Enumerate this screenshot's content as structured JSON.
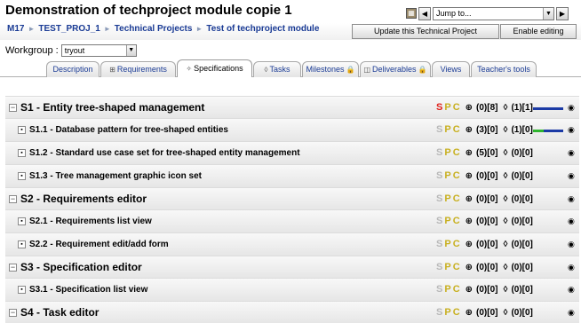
{
  "page": {
    "title": "Demonstration of techproject module copie 1"
  },
  "jump": {
    "placeholder": "Jump to...",
    "prev": "◀",
    "next": "▶",
    "dropdown": "▼"
  },
  "breadcrumb": {
    "items": [
      "M17",
      "TEST_PROJ_1",
      "Technical Projects",
      "Test of techproject module"
    ],
    "separator": "►"
  },
  "buttons": {
    "update": "Update this Technical Project",
    "edit": "Enable editing"
  },
  "workgroup": {
    "label": "Workgroup :",
    "value": "tryout"
  },
  "tabs": [
    {
      "label": "Description",
      "icon": ""
    },
    {
      "label": "Requirements",
      "icon": "⊞"
    },
    {
      "label": "Specifications",
      "icon": "✧"
    },
    {
      "label": "Tasks",
      "icon": "◊"
    },
    {
      "label": "Milestones",
      "icon": "",
      "lock": "🔒"
    },
    {
      "label": "Deliverables",
      "icon": "◫",
      "lock": "🔒"
    },
    {
      "label": "Views",
      "icon": ""
    },
    {
      "label": "Teacher's tools",
      "icon": ""
    }
  ],
  "rows": [
    {
      "level": 0,
      "label": "S1 - Entity tree-shaped management",
      "s": "S",
      "p": "P",
      "c": "C",
      "req": "(0)[8]",
      "task": "(1)[1]",
      "bar": "blue",
      "bar_fraction": 1.0
    },
    {
      "level": 1,
      "label": "S1.1 - Database pattern for tree-shaped entities",
      "s": "S",
      "p": "P",
      "c": "C",
      "req": "(3)[0]",
      "task": "(1)[0]",
      "bar": "green",
      "bar_fraction": 0.35
    },
    {
      "level": 1,
      "label": "S1.2 - Standard use case set for tree-shaped entity management",
      "s": "S",
      "p": "P",
      "c": "C",
      "req": "(5)[0]",
      "task": "(0)[0]",
      "bar": "",
      "bar_fraction": 0
    },
    {
      "level": 1,
      "label": "S1.3 - Tree management graphic icon set",
      "s": "S",
      "p": "P",
      "c": "C",
      "req": "(0)[0]",
      "task": "(0)[0]",
      "bar": "",
      "bar_fraction": 0
    },
    {
      "level": 0,
      "label": "S2 - Requirements editor",
      "s": "S",
      "p": "P",
      "c": "C",
      "req": "(0)[0]",
      "task": "(0)[0]",
      "bar": "",
      "bar_fraction": 0
    },
    {
      "level": 1,
      "label": "S2.1 - Requirements list view",
      "s": "S",
      "p": "P",
      "c": "C",
      "req": "(0)[0]",
      "task": "(0)[0]",
      "bar": "",
      "bar_fraction": 0
    },
    {
      "level": 1,
      "label": "S2.2 - Requirement edit/add form",
      "s": "S",
      "p": "P",
      "c": "C",
      "req": "(0)[0]",
      "task": "(0)[0]",
      "bar": "",
      "bar_fraction": 0
    },
    {
      "level": 0,
      "label": "S3 - Specification editor",
      "s": "S",
      "p": "P",
      "c": "C",
      "req": "(0)[0]",
      "task": "(0)[0]",
      "bar": "",
      "bar_fraction": 0
    },
    {
      "level": 1,
      "label": "S3.1 - Specification list view",
      "s": "S",
      "p": "P",
      "c": "C",
      "req": "(0)[0]",
      "task": "(0)[0]",
      "bar": "",
      "bar_fraction": 0
    },
    {
      "level": 0,
      "label": "S4 - Task editor",
      "s": "S",
      "p": "P",
      "c": "C",
      "req": "(0)[0]",
      "task": "(0)[0]",
      "bar": "",
      "bar_fraction": 0
    }
  ],
  "icons": {
    "req": "⊕",
    "task": "◊",
    "eye": "👁"
  },
  "colors": {
    "link": "#1a3b95",
    "s_active": "#e0201a",
    "bar_blue": "#1b3aa5",
    "bar_green": "#2fb52f"
  }
}
